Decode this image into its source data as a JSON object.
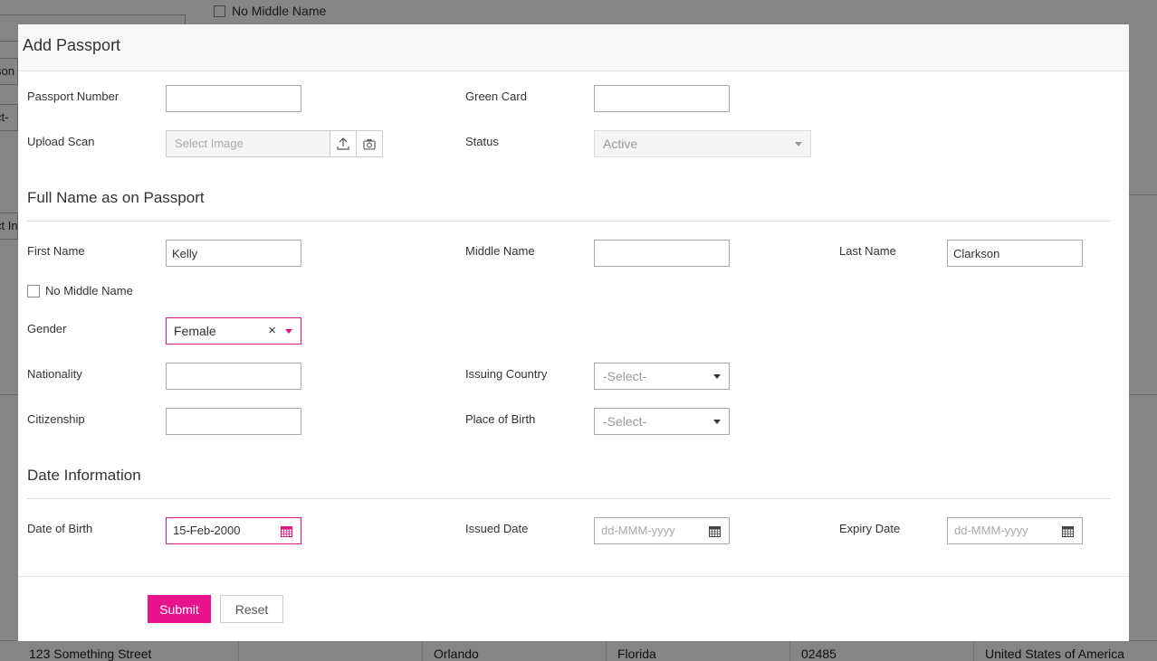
{
  "background": {
    "no_middle_name_label": "No Middle Name",
    "field_fragments": [
      "son",
      "ct-",
      "ct In"
    ],
    "address_row": [
      "123 Something Street",
      "",
      "Orlando",
      "Florida",
      "02485",
      "United States of America"
    ]
  },
  "modal": {
    "title": "Add Passport",
    "passport_number_label": "Passport Number",
    "passport_number_value": "",
    "green_card_label": "Green Card",
    "green_card_value": "",
    "upload_scan_label": "Upload Scan",
    "upload_placeholder": "Select Image",
    "status_label": "Status",
    "status_value": "Active",
    "full_name_section": "Full Name as on Passport",
    "first_name_label": "First Name",
    "first_name_value": "Kelly",
    "middle_name_label": "Middle Name",
    "middle_name_value": "",
    "last_name_label": "Last Name",
    "last_name_value": "Clarkson",
    "no_middle_name_label": "No Middle Name",
    "no_middle_name_checked": false,
    "gender_label": "Gender",
    "gender_value": "Female",
    "gender_clear": "×",
    "nationality_label": "Nationality",
    "nationality_value": "",
    "issuing_country_label": "Issuing Country",
    "issuing_country_value": "-Select-",
    "citizenship_label": "Citizenship",
    "citizenship_value": "",
    "place_of_birth_label": "Place of Birth",
    "place_of_birth_value": "-Select-",
    "date_section": "Date Information",
    "dob_label": "Date of Birth",
    "dob_value": "15-Feb-2000",
    "issued_date_label": "Issued Date",
    "issued_date_placeholder": "dd-MMM-yyyy",
    "expiry_date_label": "Expiry Date",
    "expiry_date_placeholder": "dd-MMM-yyyy",
    "submit_label": "Submit",
    "reset_label": "Reset"
  },
  "colors": {
    "accent": "#e8128c",
    "overlay": "rgba(0,0,0,0.48)"
  },
  "icons": [
    "upload-icon",
    "camera-icon",
    "calendar-icon",
    "clear-icon",
    "caret-down-icon"
  ]
}
